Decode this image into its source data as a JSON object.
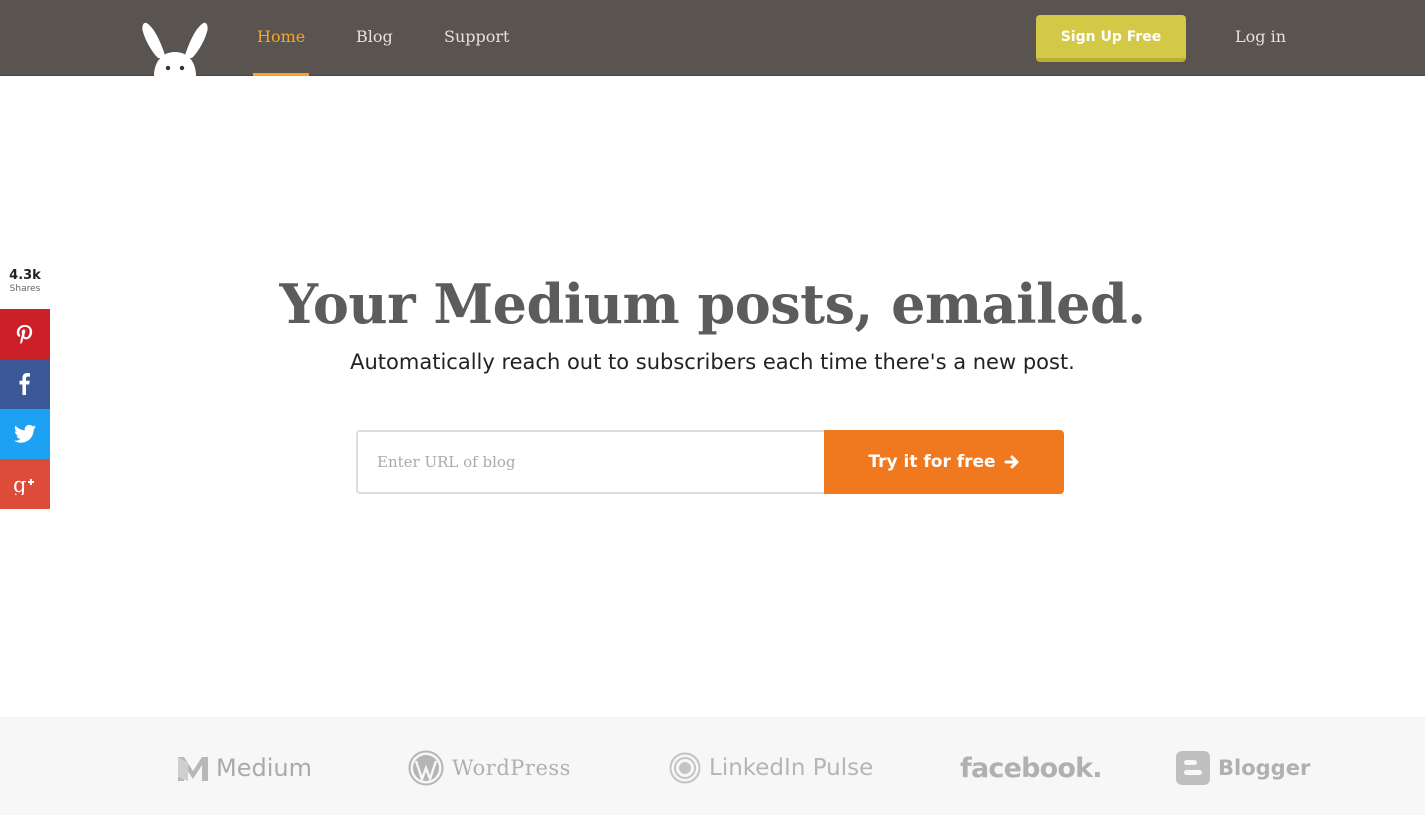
{
  "nav": {
    "home_label": "Home",
    "blog_label": "Blog",
    "support_label": "Support",
    "signup_label": "Sign Up Free",
    "login_label": "Log in",
    "logo_icon": "bunny-ears-logo"
  },
  "share": {
    "count": "4.3k",
    "count_label": "Shares",
    "buttons": [
      "pinterest-icon",
      "facebook-icon",
      "twitter-icon",
      "google-plus-icon"
    ]
  },
  "hero": {
    "title": "Your Medium posts, emailed.",
    "subtitle": "Automatically reach out to subscribers each time there's a new post.",
    "input_placeholder": "Enter URL of blog",
    "input_value": "",
    "cta_label": "Try it for free"
  },
  "platforms": {
    "medium": "Medium",
    "wordpress": "WordPress",
    "linkedin": "LinkedIn Pulse",
    "facebook": "facebook.",
    "blogger": "Blogger"
  },
  "colors": {
    "nav_bg": "#5a5450",
    "nav_active": "#f5a623",
    "signup_bg": "#d4c947",
    "cta_bg": "#f07920",
    "pinterest": "#cb2027",
    "facebook": "#3b5998",
    "twitter": "#1da1f2",
    "google_plus": "#dd4b39"
  }
}
